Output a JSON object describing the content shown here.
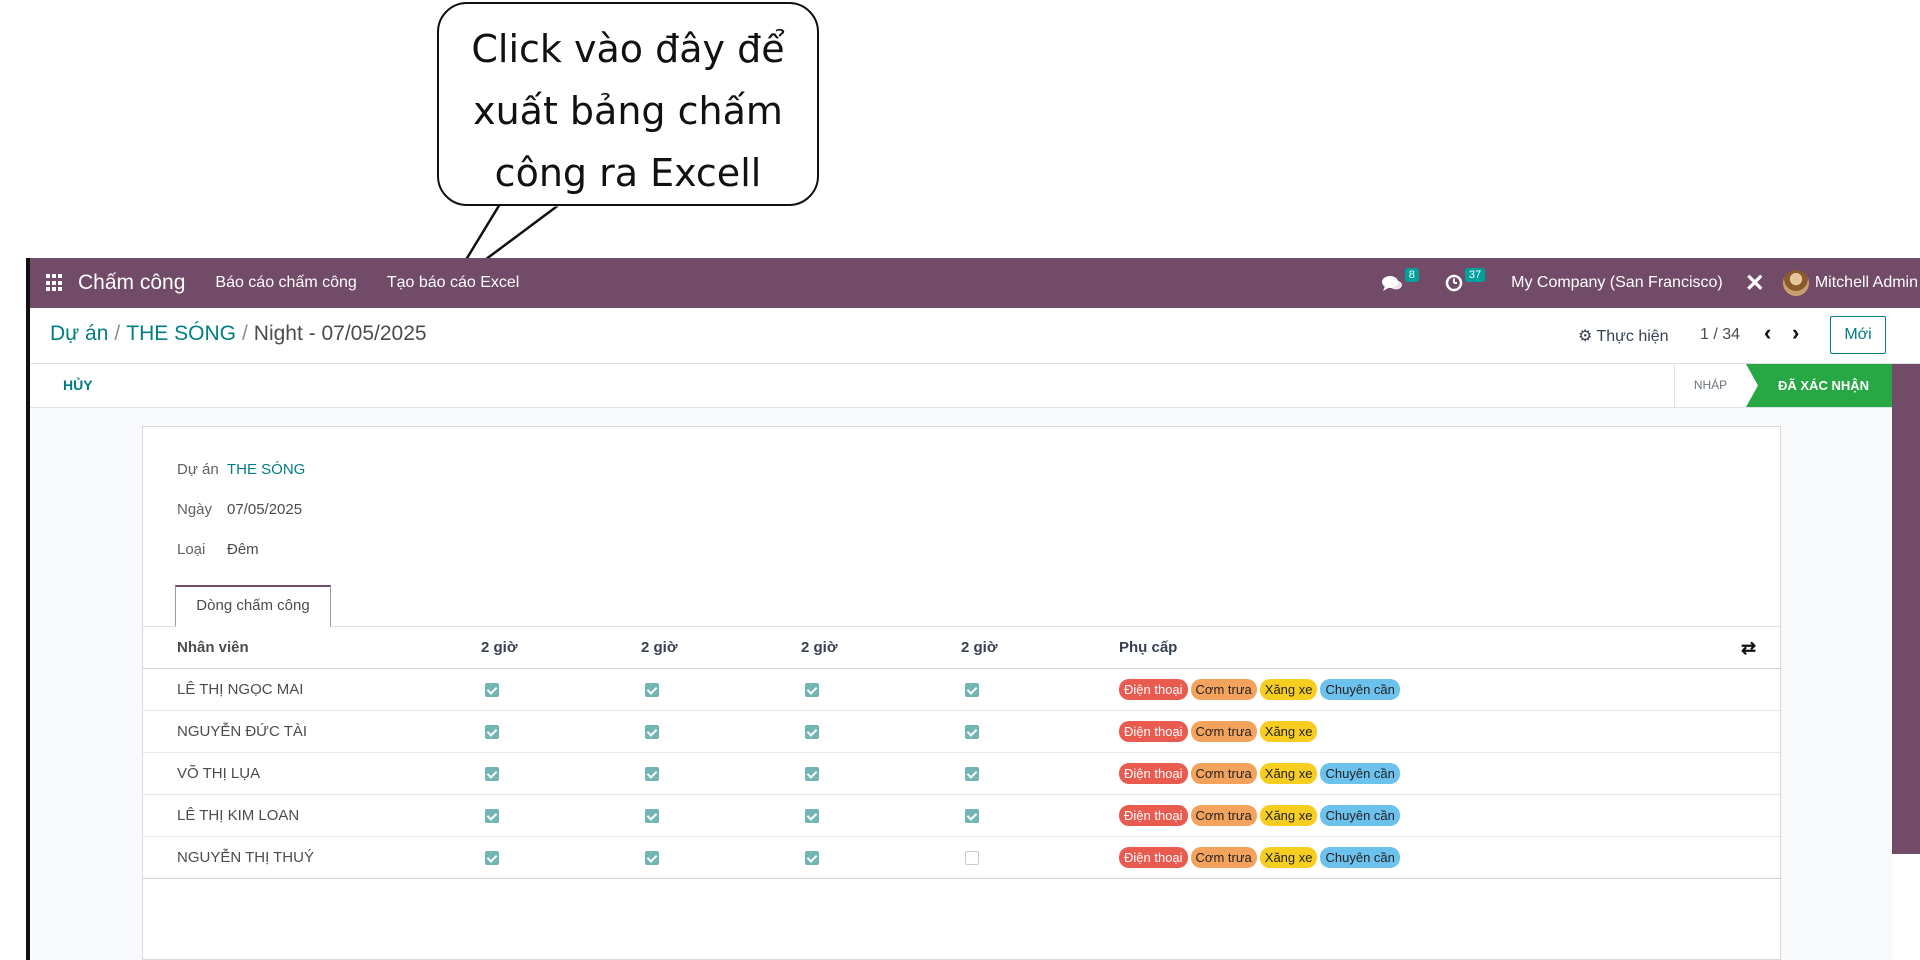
{
  "callout": {
    "line1": "Click vào đây để",
    "line2": "xuất bảng chấm",
    "line3": "công ra Excell"
  },
  "navbar": {
    "app_name": "Chấm công",
    "menu_report": "Báo cáo chấm công",
    "menu_excel": "Tạo báo cáo Excel",
    "messages_count": "8",
    "activities_count": "37",
    "company": "My Company (San Francisco)",
    "user": "Mitchell Admin"
  },
  "breadcrumb": {
    "root": "Dự án",
    "parent": "THE SÓNG",
    "current": "Night - 07/05/2025"
  },
  "control": {
    "action_label": "Thực hiện",
    "pager": "1 / 34",
    "new_label": "Mới"
  },
  "statusbar": {
    "cancel_label": "HỦY",
    "stage_draft": "NHÁP",
    "stage_confirmed": "ĐÃ XÁC NHẬN"
  },
  "form": {
    "project_label": "Dự án",
    "project_value": "THE SÓNG",
    "date_label": "Ngày",
    "date_value": "07/05/2025",
    "type_label": "Loại",
    "type_value": "Đêm",
    "tab_label": "Dòng chấm công"
  },
  "table": {
    "headers": [
      "Nhân viên",
      "2 giờ",
      "2 giờ",
      "2 giờ",
      "2 giờ",
      "Phụ cấp"
    ],
    "rows": [
      {
        "name": "LÊ THỊ NGỌC MAI",
        "checks": [
          true,
          true,
          true,
          true
        ],
        "allowances": [
          "Điện thoại",
          "Cơm trưa",
          "Xăng xe",
          "Chuyên cần"
        ]
      },
      {
        "name": "NGUYỄN ĐỨC TÀI",
        "checks": [
          true,
          true,
          true,
          true
        ],
        "allowances": [
          "Điện thoại",
          "Cơm trưa",
          "Xăng xe"
        ]
      },
      {
        "name": "VÕ THỊ LỤA",
        "checks": [
          true,
          true,
          true,
          true
        ],
        "allowances": [
          "Điện thoại",
          "Cơm trưa",
          "Xăng xe",
          "Chuyên cần"
        ]
      },
      {
        "name": "LÊ THỊ KIM LOAN",
        "checks": [
          true,
          true,
          true,
          true
        ],
        "allowances": [
          "Điện thoại",
          "Cơm trưa",
          "Xăng xe",
          "Chuyên cần"
        ]
      },
      {
        "name": "NGUYỄN THỊ THUÝ",
        "checks": [
          true,
          true,
          true,
          false
        ],
        "allowances": [
          "Điện thoại",
          "Cơm trưa",
          "Xăng xe",
          "Chuyên cần"
        ]
      }
    ]
  },
  "colors": {
    "navbar": "#714b67",
    "link": "#017e84",
    "stage_done": "#28a745",
    "tag_phone": "#ea5b4f",
    "tag_lunch": "#f4a35c",
    "tag_fuel": "#f7cd1f",
    "tag_diligence": "#6cc1ed"
  }
}
